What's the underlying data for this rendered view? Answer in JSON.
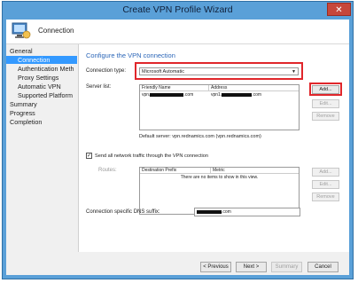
{
  "window": {
    "title": "Create VPN Profile Wizard",
    "close_glyph": "✕"
  },
  "header": {
    "page_title": "Connection"
  },
  "nav": {
    "items": [
      {
        "label": "General"
      },
      {
        "label": "Connection"
      },
      {
        "label": "Authentication Meth"
      },
      {
        "label": "Proxy Settings"
      },
      {
        "label": "Automatic VPN"
      },
      {
        "label": "Supported Platform"
      },
      {
        "label": "Summary"
      },
      {
        "label": "Progress"
      },
      {
        "label": "Completion"
      }
    ]
  },
  "main": {
    "section_title": "Configure the VPN connection",
    "connection_type_label": "Connection type:",
    "connection_type_value": "Microsoft Automatic",
    "server_list_label": "Server list:",
    "server_columns": [
      "Friendly Name",
      "Address"
    ],
    "server_rows": [
      {
        "name_prefix": "vpn.",
        "name_suffix": ".com",
        "addr_prefix": "vpn1.",
        "addr_suffix": ".com"
      }
    ],
    "server_buttons": {
      "add": "Add...",
      "edit": "Edit...",
      "remove": "Remove"
    },
    "default_server": "Default server: vpn.rednamics.com (vpn.rednamics.com)",
    "send_all_traffic": "Send all network traffic through the VPN connection",
    "routes_label": "Routes:",
    "routes_columns": [
      "Destination Prefix",
      "Metric"
    ],
    "routes_empty": "There are no items to show in this view.",
    "routes_buttons": {
      "add": "Add...",
      "edit": "Edit...",
      "remove": "Remove"
    },
    "dns_label": "Connection specific DNS suffix:",
    "dns_suffix": ".com"
  },
  "footer": {
    "previous": "< Previous",
    "next": "Next >",
    "summary": "Summary",
    "cancel": "Cancel"
  },
  "colors": {
    "accent": "#3399ff",
    "highlight": "#e0262b",
    "title_bar": "#5aa0d8",
    "section_title": "#2b66b8"
  }
}
